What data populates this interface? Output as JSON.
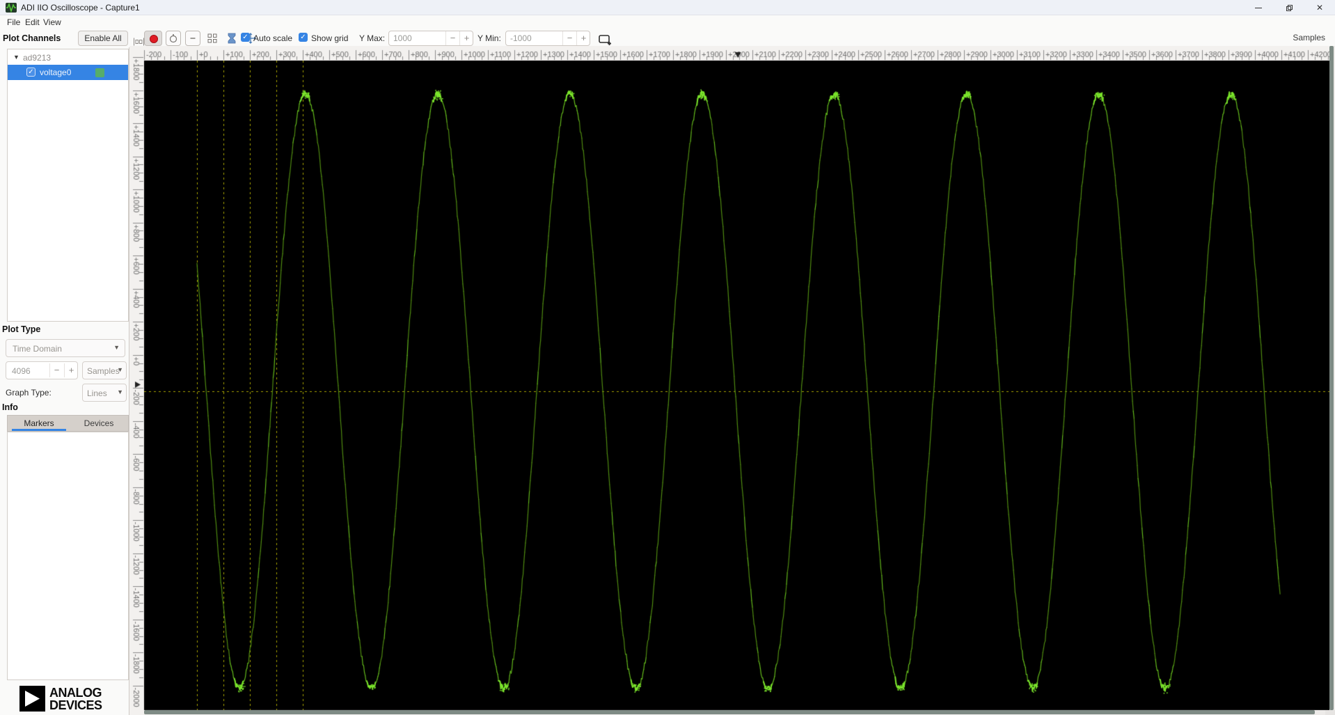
{
  "window": {
    "title": "ADI IIO Oscilloscope - Capture1"
  },
  "menu": {
    "items": [
      "File",
      "Edit",
      "View"
    ]
  },
  "toolbar": {
    "auto_scale_label": "Auto scale",
    "auto_scale_checked": true,
    "show_grid_label": "Show grid",
    "show_grid_checked": true,
    "y_max_label": "Y Max:",
    "y_max_value": "1000",
    "y_min_label": "Y Min:",
    "y_min_value": "-1000",
    "samples_axis_label": "Samples",
    "check_glyph": "✓"
  },
  "sidebar": {
    "plot_channels_label": "Plot Channels",
    "enable_all_label": "Enable All",
    "device_tree": {
      "device": "ad9213",
      "channels": [
        {
          "name": "voltage0",
          "checked": true,
          "selected": true,
          "color": "#56ad6a"
        }
      ]
    },
    "plot_type_label": "Plot Type",
    "plot_type_value": "Time Domain",
    "sample_count_value": "4096",
    "sample_unit_value": "Samples",
    "graph_type_label": "Graph Type:",
    "graph_type_value": "Lines",
    "info_label": "Info",
    "tabs": [
      {
        "label": "Markers",
        "active": true
      },
      {
        "label": "Devices",
        "active": false
      }
    ],
    "logo_line1": "ANALOG",
    "logo_line2": "DEVICES"
  },
  "colors": {
    "accent": "#3584e4",
    "record_red": "#e01b24",
    "plot_background": "#000000",
    "grid": "#a8a500",
    "wave_dark": "#4f8a11",
    "wave_mid": "#63b81c",
    "wave_bright": "#7ce62c",
    "ruler_bg": "#f3f1ef",
    "ruler_text": "#6f6f6f"
  },
  "chart_data": {
    "type": "line",
    "title": "",
    "xlabel": "Samples",
    "x_axis": {
      "min": -200,
      "visible_max": 4281,
      "last_label": 4200,
      "major_tick_step": 100,
      "minor_tick_step": 25,
      "label_format": "explicit-sign"
    },
    "y_axis": {
      "top_label": 1800,
      "bottom_label": -2000,
      "major_tick_step": 200,
      "minor_tick_step": 50,
      "label_format": "explicit-sign",
      "labels_rotated_deg": 90
    },
    "series": [
      {
        "name": "voltage0",
        "waveform": "sine",
        "samples": 4096,
        "period_samples": 500,
        "first_peak_sample": 410,
        "amplitude": 1780,
        "offset": 0,
        "noise_amplitude": 18,
        "color_dark": "#4f8a11",
        "color_mid": "#63b81c",
        "color_bright": "#7ce62c"
      }
    ],
    "grid": {
      "shown": true,
      "color": "#a8a500",
      "vlines_at_samples": [
        0,
        100,
        200,
        300,
        400
      ],
      "hlines_at_values": [
        0
      ]
    },
    "ruler_markers": {
      "x_sample": 2045,
      "y_value": 40
    },
    "background": "#000000",
    "legend": "none"
  }
}
